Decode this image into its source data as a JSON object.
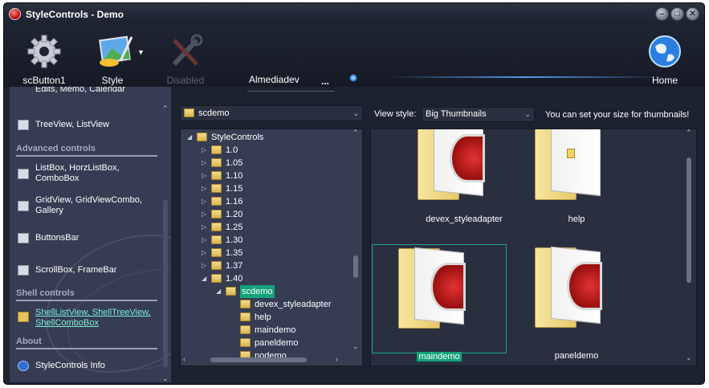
{
  "window": {
    "title": "StyleControls - Demo",
    "min": "–",
    "max": "□",
    "close": "✕"
  },
  "toolbar": {
    "button1": "scButton1",
    "style": "Style",
    "disabled": "Disabled",
    "home": "Home",
    "edit_value": "Almediadev",
    "edit_dots": "..."
  },
  "sidebar": {
    "items_top": [
      {
        "label": "Edits, Memo, Calendar"
      },
      {
        "label": "TreeView, ListView"
      }
    ],
    "advanced_header": "Advanced controls",
    "advanced": [
      {
        "label": "ListBox, HorzListBox, ComboBox"
      },
      {
        "label": "GridView, GridViewCombo, Gallery"
      },
      {
        "label": "ButtonsBar"
      },
      {
        "label": "ScrollBox, FrameBar"
      }
    ],
    "shell_header": "Shell controls",
    "shell": [
      {
        "label": "ShellListView, ShellTreeView, ShellComboBox"
      }
    ],
    "about_header": "About",
    "about": [
      {
        "label": "StyleControls Info"
      }
    ]
  },
  "combo": {
    "value": "scdemo"
  },
  "tree": {
    "root": "StyleControls",
    "versions": [
      "1.0",
      "1.05",
      "1.10",
      "1.15",
      "1.16",
      "1.20",
      "1.25",
      "1.30",
      "1.35",
      "1.37",
      "1.40"
    ],
    "selected": "scdemo",
    "children": [
      "devex_styleadapter",
      "help",
      "maindemo",
      "paneldemo",
      "nodemo"
    ]
  },
  "view": {
    "label": "View style:",
    "value": "Big Thumbnails",
    "hint": "You can set your size for thumbnails!"
  },
  "thumbnails": [
    {
      "caption": "devex_styleadapter"
    },
    {
      "caption": "help"
    },
    {
      "caption": "maindemo"
    },
    {
      "caption": "paneldemo"
    }
  ],
  "colors": {
    "accent": "#14a37a",
    "panel": "#363c52",
    "frame": "#1d2230"
  }
}
